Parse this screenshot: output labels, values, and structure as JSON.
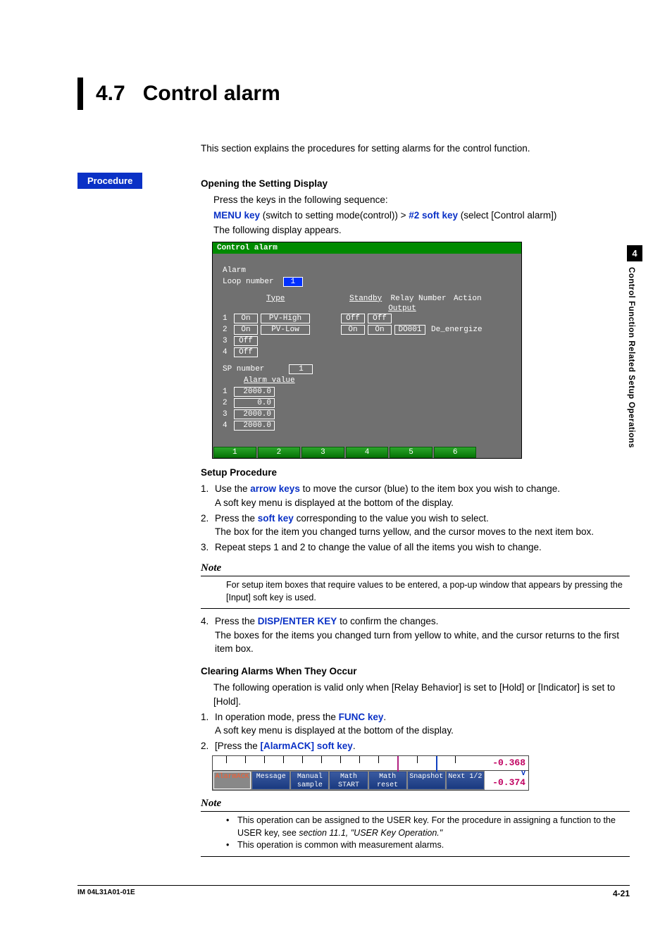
{
  "section": {
    "number": "4.7",
    "title": "Control alarm"
  },
  "intro": "This section explains the procedures for setting alarms for the control function.",
  "procedure_label": "Procedure",
  "opening": {
    "heading": "Opening the Setting Display",
    "line1": "Press the keys in the following sequence:",
    "menu_key": "MENU key",
    "menu_after": " (switch to setting mode(control)) > ",
    "soft_key": "#2 soft key",
    "soft_after": " (select [Control alarm])",
    "line3": "The following display appears."
  },
  "device1": {
    "title": "Control alarm",
    "alarm_label": "Alarm",
    "loop_label": "Loop number",
    "loop_value": "1",
    "hdr": {
      "type": "Type",
      "standby": "Standby",
      "relay": "Relay",
      "output": "Output",
      "number": "Number",
      "action": "Action"
    },
    "rows": [
      {
        "n": "1",
        "on": "On",
        "type": "PV-High",
        "standby": "Off",
        "out": "Off",
        "num": "",
        "act": ""
      },
      {
        "n": "2",
        "on": "On",
        "type": "PV-Low",
        "standby": "On",
        "out": "On",
        "num": "DO001",
        "act": "De_energize"
      },
      {
        "n": "3",
        "on": "Off",
        "type": "",
        "standby": "",
        "out": "",
        "num": "",
        "act": ""
      },
      {
        "n": "4",
        "on": "Off",
        "type": "",
        "standby": "",
        "out": "",
        "num": "",
        "act": ""
      }
    ],
    "sp_label": "SP number",
    "sp_value": "1",
    "av_label": "Alarm value",
    "av": [
      "2000.0",
      "0.0",
      "2000.0",
      "2000.0"
    ],
    "soft": [
      "1",
      "2",
      "3",
      "4",
      "5",
      "6"
    ]
  },
  "setup": {
    "heading": "Setup Procedure",
    "s1a": "Use the ",
    "s1key": "arrow keys",
    "s1b": " to move the cursor (blue) to the item box you wish to change.",
    "s1c": "A soft key menu is displayed at the bottom of the display.",
    "s2a": "Press the ",
    "s2key": "soft key",
    "s2b": " corresponding to the value you wish to select.",
    "s2c": "The box for the item you changed turns yellow, and the cursor moves to the next item box.",
    "s3": "Repeat steps 1 and 2 to change the value of all the items you wish to change."
  },
  "note1": {
    "label": "Note",
    "body": "For setup item boxes that require values to be entered, a pop-up window that appears by pressing the [Input] soft key is used."
  },
  "step4": {
    "a": "Press the ",
    "key": "DISP/ENTER KEY",
    "b": " to confirm the changes.",
    "c": "The boxes for the items you changed turn from yellow to white, and the cursor returns to the first item box."
  },
  "clearing": {
    "heading": "Clearing Alarms When They Occur",
    "intro": "The following operation is valid only when [Relay Behavior] is set to [Hold] or [Indicator] is set to [Hold].",
    "s1a": "In operation mode, press the ",
    "s1key": "FUNC key",
    "s1b": ".",
    "s1c": "A soft key menu is displayed at the bottom of the display.",
    "s2a": "[Press the ",
    "s2key": "[AlarmACK] soft key",
    "s2b": "."
  },
  "device2": {
    "val_top": "-0.368",
    "unit": "V",
    "val_bot": "-0.374",
    "buttons": [
      {
        "l1": "AlarmACK",
        "l2": "",
        "sel": true
      },
      {
        "l1": "Message",
        "l2": ""
      },
      {
        "l1": "Manual",
        "l2": "sample"
      },
      {
        "l1": "Math",
        "l2": "START"
      },
      {
        "l1": "Math",
        "l2": "reset"
      },
      {
        "l1": "Snapshot",
        "l2": ""
      },
      {
        "l1": "Next 1/2",
        "l2": ""
      }
    ]
  },
  "note2": {
    "label": "Note",
    "b1a": "This operation can be assigned to the USER key.  For the procedure in assigning a function to the USER key, see ",
    "b1ref": "section 11.1, \"USER Key Operation.\"",
    "b2": "This operation is common with measurement alarms."
  },
  "side": {
    "chapter": "4",
    "label": "Control Function Related Setup Operations"
  },
  "footer": {
    "left": "IM 04L31A01-01E",
    "right": "4-21"
  }
}
